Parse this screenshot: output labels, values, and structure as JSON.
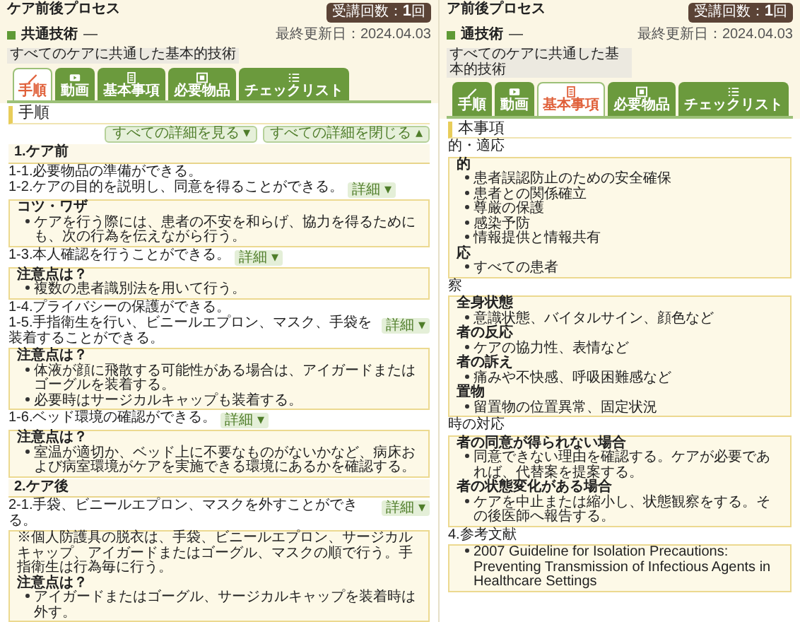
{
  "windows": [
    {
      "title": "ケア前後プロセス",
      "attendance": "受講回数：**1**回",
      "category": "共通技術",
      "separator": "—",
      "subtitle": "すべてのケアに共通した基本的技術",
      "last_updated": "最終更新日：2024.04.03",
      "tabs": [
        {
          "label": "手順",
          "selected": true
        },
        {
          "label": "動画",
          "selected": false
        },
        {
          "label": "基本事項",
          "selected": false
        },
        {
          "label": "必要物品",
          "selected": false
        },
        {
          "label": "チェックリスト",
          "selected": false
        }
      ],
      "section_title": "手順",
      "toggle_buttons": [
        {
          "label": "すべての詳細を見る ▾"
        },
        {
          "label": "すべての詳細を閉じる ▴"
        }
      ],
      "groups": [
        {
          "heading": "1.ケア前",
          "steps": [
            {
              "text": "1-1.必要物品の準備ができる。"
            },
            {
              "text": "1-2.ケアの目的を説明し、同意を得ることができる。",
              "detail_button": "詳細 ▾",
              "note": [
                {
                  "kind": "heading",
                  "text": "コツ・ワザ"
                },
                {
                  "kind": "bullet",
                  "text": "ケアを行う際には、患者の不安を和らげ、協力を得るためにも、次の行為を伝えながら行う。"
                }
              ]
            },
            {
              "text": "1-3.本人確認を行うことができる。",
              "detail_button": "詳細 ▾",
              "note": [
                {
                  "kind": "heading",
                  "text": "注意点は？"
                },
                {
                  "kind": "bullet",
                  "text": "複数の患者識別法を用いて行う。"
                }
              ]
            },
            {
              "text": "1-4.プライバシーの保護ができる。"
            },
            {
              "text": "1-5.手指衛生を行い、ビニールエプロン、マスク、手袋を装着することができる。",
              "detail_button": "詳細 ▾",
              "note": [
                {
                  "kind": "heading",
                  "text": "注意点は？"
                },
                {
                  "kind": "bullet",
                  "text": "体液が顔に飛散する可能性がある場合は、アイガードまたはゴーグルを装着する。"
                },
                {
                  "kind": "bullet",
                  "text": "必要時はサージカルキャップも装着する。"
                }
              ]
            },
            {
              "text": "1-6.ベッド環境の確認ができる。",
              "detail_button": "詳細 ▾",
              "note": [
                {
                  "kind": "heading",
                  "text": "注意点は？"
                },
                {
                  "kind": "bullet",
                  "text": "室温が適切か、ベッド上に不要なものがないかなど、病床および病室環境がケアを実施できる環境にあるかを確認する。"
                }
              ]
            }
          ]
        },
        {
          "heading": "2.ケア後",
          "steps": [
            {
              "text": "2-1.手袋、ビニールエプロン、マスクを外すことができる。",
              "detail_button": "詳細 ▾",
              "note": [
                {
                  "kind": "text",
                  "text": "※個人防護具の脱衣は、手袋、ビニールエプロン、サージカルキャップ、アイガードまたはゴーグル、マスクの順で行う。手指衛生は行為毎に行う。"
                },
                {
                  "kind": "heading",
                  "text": "注意点は？"
                },
                {
                  "kind": "bullet",
                  "text": "アイガードまたはゴーグル、サージカルキャップを装着時は外す。"
                }
              ]
            }
          ]
        }
      ]
    },
    {
      "title": "ア前後プロセス",
      "attendance": "受講回数：**1**回",
      "category": "通技術",
      "separator": "—",
      "subtitle": "すべてのケアに共通した基本的技術",
      "last_updated": "最終更新日：2024.04.03",
      "tabs": [
        {
          "label": "手順",
          "selected": false
        },
        {
          "label": "動画",
          "selected": false
        },
        {
          "label": "基本事項",
          "selected": true
        },
        {
          "label": "必要物品",
          "selected": false
        },
        {
          "label": "チェックリスト",
          "selected": false
        }
      ],
      "section_title": "本事項",
      "sections": [
        {
          "heading": "的・適応",
          "note": [
            {
              "kind": "heading",
              "text": "的"
            },
            {
              "kind": "bullet",
              "text": "患者誤認防止のための安全確保"
            },
            {
              "kind": "bullet",
              "text": "患者との関係確立"
            },
            {
              "kind": "bullet",
              "text": "尊厳の保護"
            },
            {
              "kind": "bullet",
              "text": "感染予防"
            },
            {
              "kind": "bullet",
              "text": "情報提供と情報共有"
            },
            {
              "kind": "heading",
              "text": "応"
            },
            {
              "kind": "bullet",
              "text": "すべての患者"
            }
          ]
        },
        {
          "heading": "察",
          "note": [
            {
              "kind": "heading",
              "text": "全身状態"
            },
            {
              "kind": "bullet",
              "text": "意識状態、バイタルサイン、顔色など"
            },
            {
              "kind": "heading",
              "text": "者の反応"
            },
            {
              "kind": "bullet",
              "text": "ケアの協力性、表情など"
            },
            {
              "kind": "heading",
              "text": "者の訴え"
            },
            {
              "kind": "bullet",
              "text": "痛みや不快感、呼吸困難感など"
            },
            {
              "kind": "heading",
              "text": "置物"
            },
            {
              "kind": "bullet",
              "text": "留置物の位置異常、固定状況"
            }
          ]
        },
        {
          "heading": "時の対応",
          "note": [
            {
              "kind": "heading",
              "text": "者の同意が得られない場合"
            },
            {
              "kind": "bullet",
              "text": "同意できない理由を確認する。ケアが必要であれば、代替案を提案する。"
            },
            {
              "kind": "heading",
              "text": "者の状態変化がある場合"
            },
            {
              "kind": "bullet",
              "text": "ケアを中止または縮小し、状態観察をする。その後医師へ報告する。"
            }
          ]
        },
        {
          "heading": "4.参考文献",
          "note": [
            {
              "kind": "bullet",
              "text": "2007 Guideline for Isolation Precautions: Preventing Transmission of Infectious Agents in Healthcare Settings"
            }
          ]
        }
      ]
    }
  ]
}
